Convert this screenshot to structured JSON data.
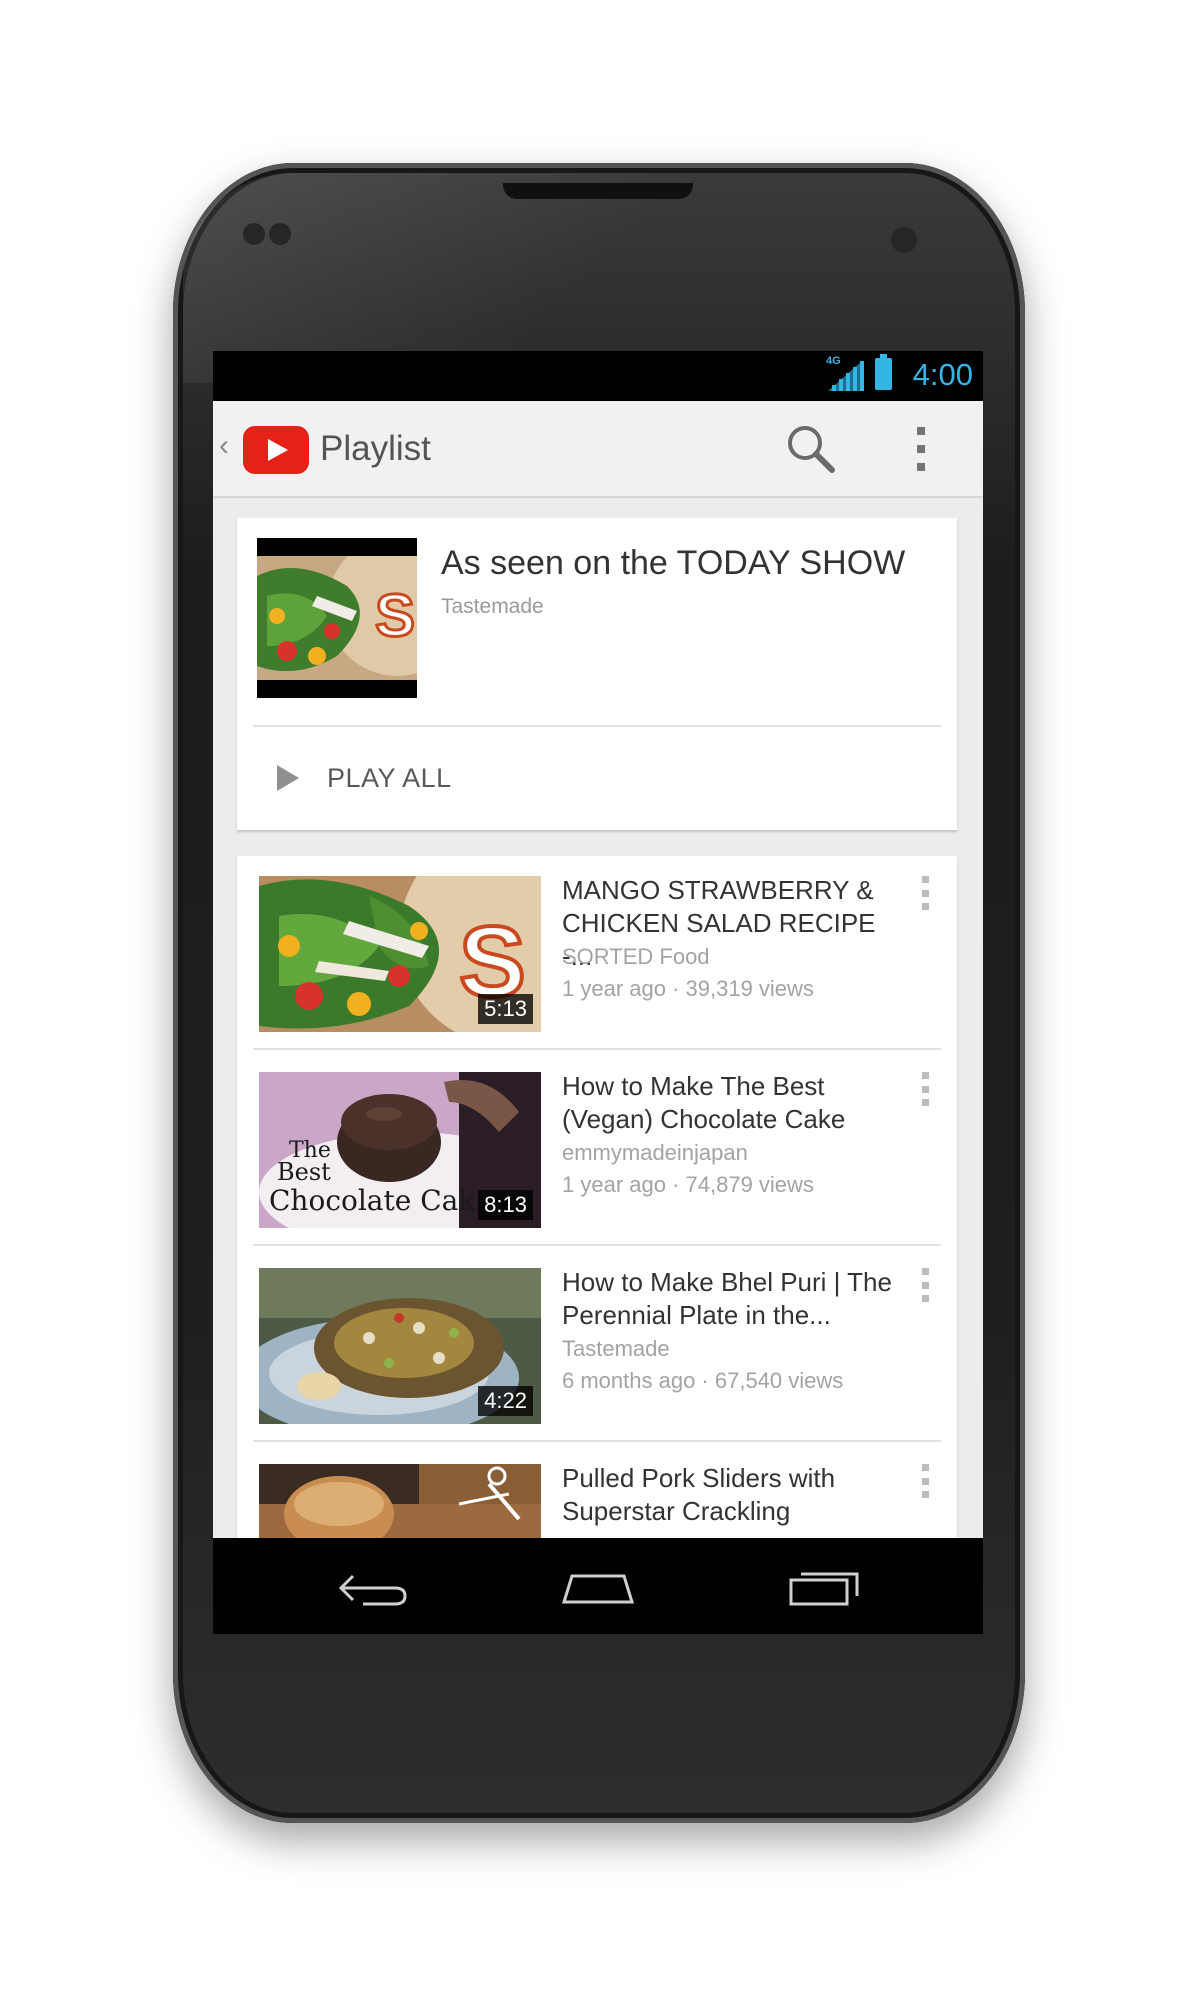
{
  "status_bar": {
    "network": "4G",
    "time": "4:00",
    "accent_color": "#33b5e5"
  },
  "action_bar": {
    "title": "Playlist",
    "logo": "youtube-logo",
    "icons": [
      "search-icon",
      "overflow-menu-icon"
    ]
  },
  "playlist": {
    "title": "As seen on the TODAY SHOW",
    "channel": "Tastemade",
    "play_all_label": "PLAY ALL"
  },
  "videos": [
    {
      "title": "MANGO STRAWBERRY & CHICKEN SALAD RECIPE -...",
      "channel": "SORTED Food",
      "meta": "1 year ago · 39,319 views",
      "duration": "5:13"
    },
    {
      "title": "How to Make The Best (Vegan) Chocolate Cake",
      "channel": "emmymadeinjapan",
      "meta": "1 year ago · 74,879 views",
      "duration": "8:13",
      "thumb_text": [
        "The",
        "Best",
        "Chocolate Cak"
      ]
    },
    {
      "title": "How to Make Bhel Puri | The Perennial Plate in the...",
      "channel": "Tastemade",
      "meta": "6 months ago · 67,540 views",
      "duration": "4:22"
    },
    {
      "title": "Pulled Pork Sliders with Superstar Crackling",
      "channel": "",
      "meta": "",
      "duration": ""
    }
  ],
  "nav_bar": {
    "icons": [
      "back-icon",
      "home-icon",
      "recent-apps-icon"
    ]
  }
}
